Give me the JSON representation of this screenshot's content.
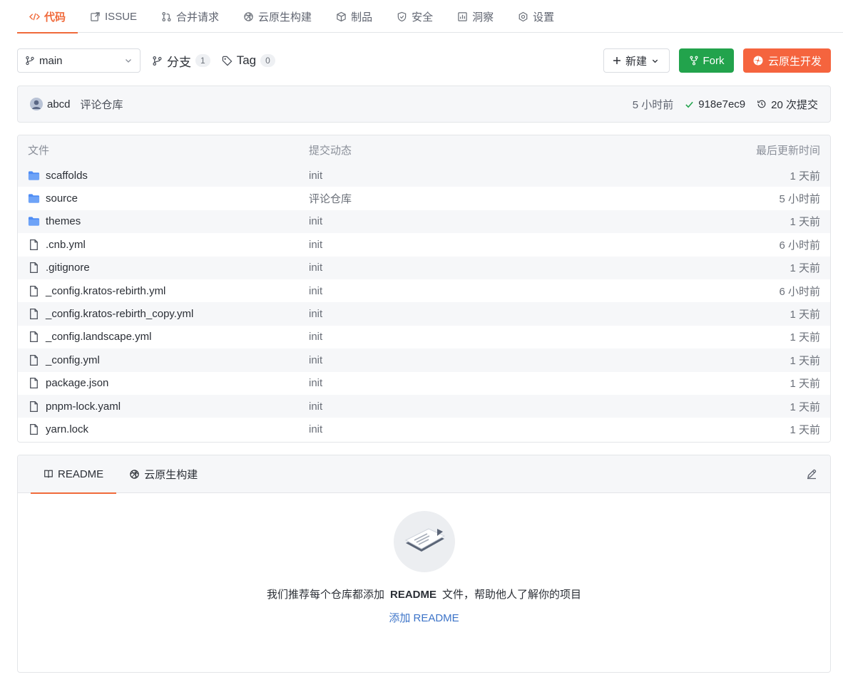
{
  "nav": {
    "tabs": [
      {
        "label": "代码",
        "icon": "code-icon",
        "active": true
      },
      {
        "label": "ISSUE",
        "icon": "issue-icon"
      },
      {
        "label": "合并请求",
        "icon": "pull-request-icon"
      },
      {
        "label": "云原生构建",
        "icon": "build-icon"
      },
      {
        "label": "制品",
        "icon": "package-icon"
      },
      {
        "label": "安全",
        "icon": "shield-icon"
      },
      {
        "label": "洞察",
        "icon": "chart-icon"
      },
      {
        "label": "设置",
        "icon": "gear-icon"
      }
    ]
  },
  "toolbar": {
    "branch": "main",
    "branches_label": "分支",
    "branches_count": "1",
    "tags_label": "Tag",
    "tags_count": "0",
    "new_label": "新建",
    "fork_label": "Fork",
    "cloud_label": "云原生开发"
  },
  "commit": {
    "author": "abcd",
    "message": "评论仓库",
    "time": "5 小时前",
    "hash": "918e7ec9",
    "commits_label": "20 次提交"
  },
  "files": {
    "headers": {
      "name": "文件",
      "commit": "提交动态",
      "time": "最后更新时间"
    },
    "rows": [
      {
        "name": "scaffolds",
        "type": "folder",
        "commit": "init",
        "time": "1 天前"
      },
      {
        "name": "source",
        "type": "folder",
        "commit": "评论仓库",
        "time": "5 小时前"
      },
      {
        "name": "themes",
        "type": "folder",
        "commit": "init",
        "time": "1 天前"
      },
      {
        "name": ".cnb.yml",
        "type": "file",
        "commit": "init",
        "time": "6 小时前"
      },
      {
        "name": ".gitignore",
        "type": "file",
        "commit": "init",
        "time": "1 天前"
      },
      {
        "name": "_config.kratos-rebirth.yml",
        "type": "file",
        "commit": "init",
        "time": "6 小时前"
      },
      {
        "name": "_config.kratos-rebirth_copy.yml",
        "type": "file",
        "commit": "init",
        "time": "1 天前"
      },
      {
        "name": "_config.landscape.yml",
        "type": "file",
        "commit": "init",
        "time": "1 天前"
      },
      {
        "name": "_config.yml",
        "type": "file",
        "commit": "init",
        "time": "1 天前"
      },
      {
        "name": "package.json",
        "type": "file",
        "commit": "init",
        "time": "1 天前"
      },
      {
        "name": "pnpm-lock.yaml",
        "type": "file",
        "commit": "init",
        "time": "1 天前"
      },
      {
        "name": "yarn.lock",
        "type": "file",
        "commit": "init",
        "time": "1 天前"
      }
    ]
  },
  "readme": {
    "tabs": [
      "README",
      "云原生构建"
    ],
    "empty_prefix": "我们推荐每个仓库都添加",
    "empty_bold": "README",
    "empty_suffix": "文件，帮助他人了解你的项目",
    "add_link": "添加 README"
  },
  "colors": {
    "accent": "#f06a3b",
    "fork": "#22a34c",
    "cloud": "#f5643e",
    "folder": "#4f8df5",
    "link": "#3d74c8"
  }
}
